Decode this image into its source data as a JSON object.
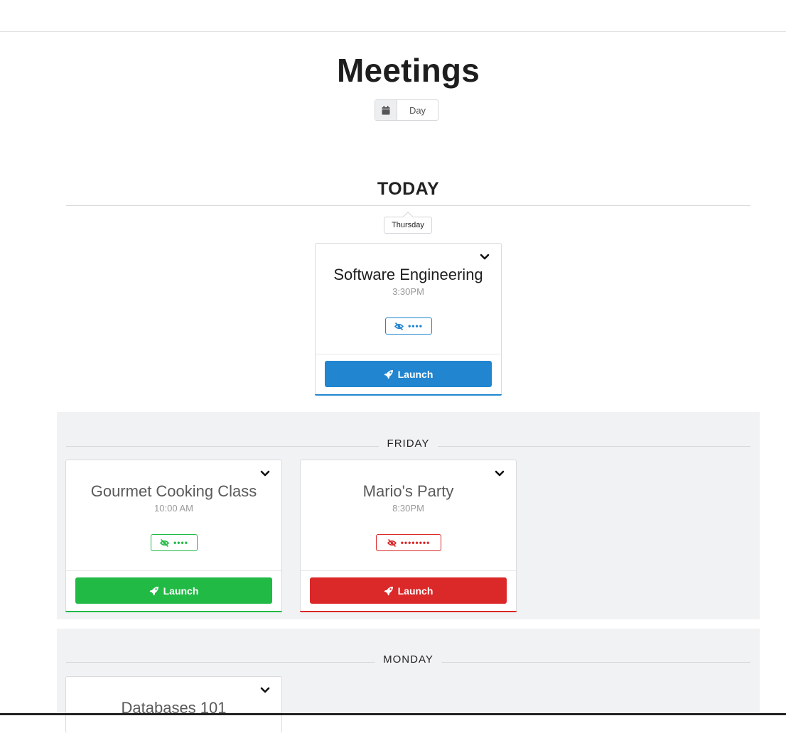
{
  "page": {
    "title": "Meetings"
  },
  "view_toggle": {
    "label": "Day"
  },
  "today": {
    "heading": "TODAY",
    "day": "Thursday",
    "meetings": [
      {
        "title": "Software Engineering",
        "time": "3:30PM",
        "password": "••••",
        "launch_label": "Launch",
        "color": "#2185d0"
      }
    ]
  },
  "friday": {
    "heading": "FRIDAY",
    "meetings": [
      {
        "title": "Gourmet Cooking Class",
        "time": "10:00 AM",
        "password": "••••",
        "launch_label": "Launch",
        "color": "#21ba45"
      },
      {
        "title": "Mario's Party",
        "time": "8:30PM",
        "password": "••••••••",
        "launch_label": "Launch",
        "color": "#db2828"
      }
    ]
  },
  "monday": {
    "heading": "MONDAY",
    "meetings": [
      {
        "title": "Databases 101"
      }
    ]
  }
}
